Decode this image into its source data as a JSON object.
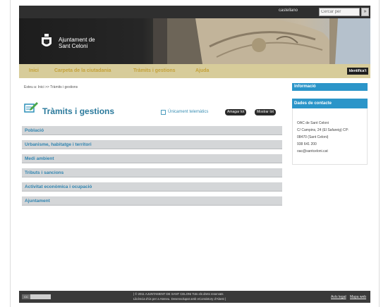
{
  "topbar": {
    "language": "castellano",
    "search_placeholder": "Cercar per",
    "search_button": "»"
  },
  "banner": {
    "title_line1": "Ajuntament de",
    "title_line2": "Sant Celoni"
  },
  "nav": {
    "items": [
      "Inici",
      "Carpeta de la ciutadania",
      "Tràmits i gestions",
      "Ajuda"
    ],
    "identifica": "Identifica't"
  },
  "breadcrumb": "Esteu a: Inici >> Tràmits i gestions",
  "page": {
    "title": "Tràmits i gestions",
    "telematic_label": "Únicament telemàtics",
    "collapse_all": "Amagar tot",
    "expand_all": "Mostrar tot"
  },
  "categories": [
    "Població",
    "Urbanisme, habitatge i territori",
    "Medi ambient",
    "Tributs i sancions",
    "Activitat econòmica i ocupació",
    "Ajuntament"
  ],
  "sidebar": {
    "info_title": "Informació",
    "contact_title": "Dades de contacte",
    "contact_lines": [
      "OAC de Sant Celoni",
      "C/ Campins, 24 (El Safareig) CP:",
      "08470 (Sant Celoni)",
      "938 641 200",
      "oac@santceloni.cat"
    ]
  },
  "footer": {
    "badge": "CC",
    "line1": "| © 2011 AJUNTAMENT DE SANT CELONI Tots els drets reservats",
    "line2": "Llicència d'ús per a Ateneu. Desenvolupat amb eConsistory d'Abest |",
    "link_legal": "Avís legal",
    "link_map": "Mapa web"
  },
  "colors": {
    "nav_bg": "#d7cc9a",
    "nav_text": "#c4a23a",
    "accent_blue": "#2b95c9",
    "title_blue": "#2b7a9c",
    "row_bg": "#d4d6d8"
  }
}
